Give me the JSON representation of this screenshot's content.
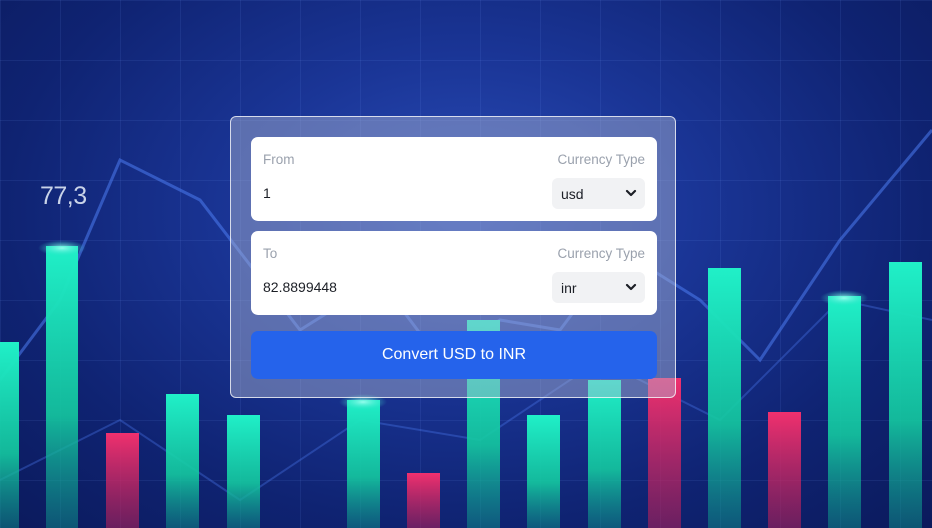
{
  "background": {
    "ticker_value": "77,3",
    "colors": {
      "bull": "#19d9b0",
      "bear": "#e8326a",
      "bg": "#1a3596"
    }
  },
  "converter": {
    "from": {
      "label": "From",
      "amount": "1",
      "currency_label": "Currency Type",
      "currency": "usd"
    },
    "to": {
      "label": "To",
      "amount": "82.8899448",
      "currency_label": "Currency Type",
      "currency": "inr"
    },
    "convert_button_label": "Convert USD to INR",
    "accent_color": "#2563eb"
  }
}
